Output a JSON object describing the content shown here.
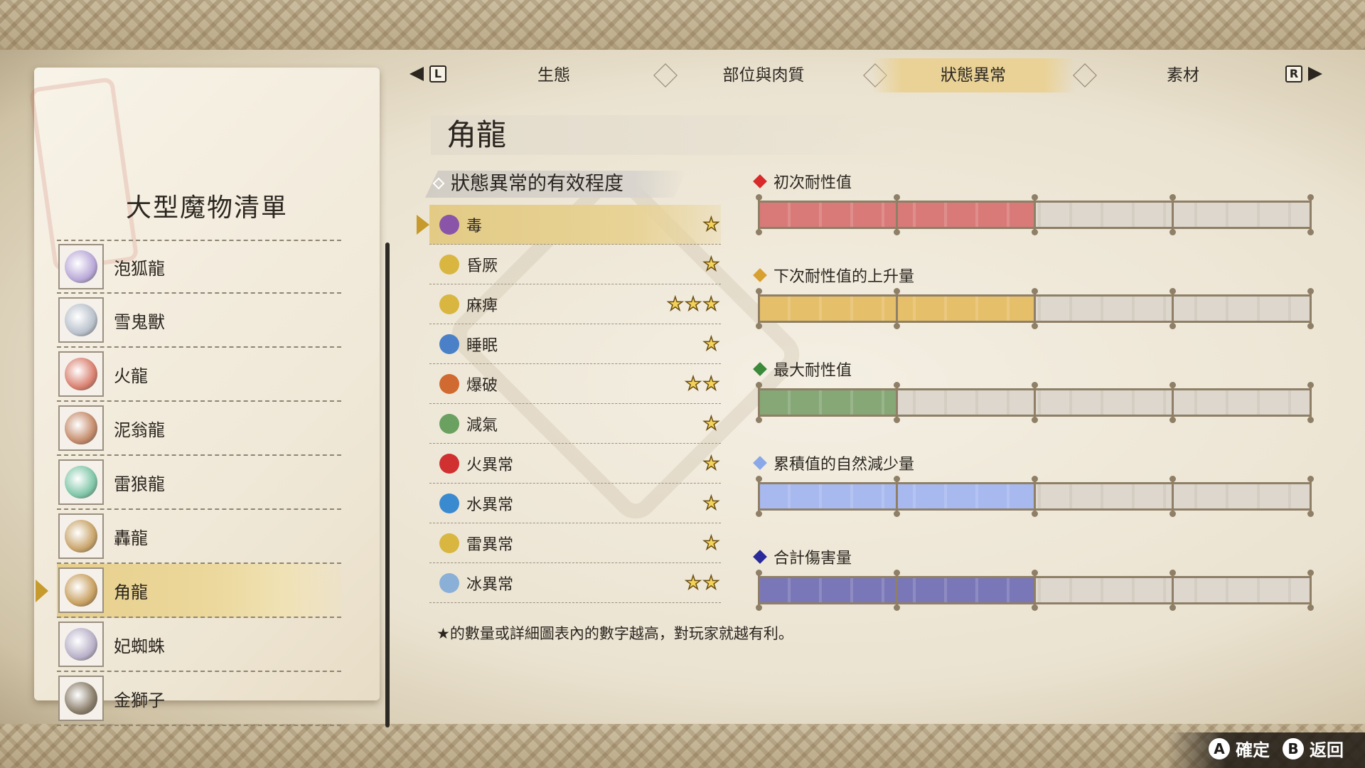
{
  "tabs": [
    {
      "label": "生態",
      "active": false
    },
    {
      "label": "部位與肉質",
      "active": false
    },
    {
      "label": "狀態異常",
      "active": true
    },
    {
      "label": "素材",
      "active": false
    }
  ],
  "tab_nav": {
    "left": "L",
    "right": "R"
  },
  "left_panel": {
    "title": "大型魔物清單",
    "monsters": [
      {
        "name": "泡狐龍",
        "icon": "mizutsune-icon",
        "color": "#b9a8d8"
      },
      {
        "name": "雪鬼獸",
        "icon": "goss-harag-icon",
        "color": "#b9c1cc"
      },
      {
        "name": "火龍",
        "icon": "rathalos-icon",
        "color": "#d9806f"
      },
      {
        "name": "泥翁龍",
        "icon": "almudron-icon",
        "color": "#c48a6a"
      },
      {
        "name": "雷狼龍",
        "icon": "zinogre-icon",
        "color": "#7fc6a8"
      },
      {
        "name": "轟龍",
        "icon": "tigrex-icon",
        "color": "#c9a46a"
      },
      {
        "name": "角龍",
        "icon": "diablos-icon",
        "color": "#c8a060",
        "selected": true
      },
      {
        "name": "妃蜘蛛",
        "icon": "rakna-kadaki-icon",
        "color": "#b8b0c8"
      },
      {
        "name": "金獅子",
        "icon": "rajang-icon",
        "color": "#8a7d6a"
      }
    ],
    "scroll": {
      "position": 0.65
    }
  },
  "monster_title": "角龍",
  "section_header": "狀態異常的有效程度",
  "status_effects": [
    {
      "name": "毒",
      "stars": "★",
      "icon": "poison-icon",
      "color": "#8a55a8",
      "selected": true
    },
    {
      "name": "昏厥",
      "stars": "★",
      "icon": "stun-icon",
      "color": "#d8b640"
    },
    {
      "name": "麻痺",
      "stars": "★★★",
      "icon": "paralysis-icon",
      "color": "#d8b640"
    },
    {
      "name": "睡眠",
      "stars": "★",
      "icon": "sleep-icon",
      "color": "#4a80c8"
    },
    {
      "name": "爆破",
      "stars": "★★",
      "icon": "blast-icon",
      "color": "#d06a30"
    },
    {
      "name": "減氣",
      "stars": "★",
      "icon": "exhaust-icon",
      "color": "#6aa060"
    },
    {
      "name": "火異常",
      "stars": "★",
      "icon": "fireblight-icon",
      "color": "#d03030"
    },
    {
      "name": "水異常",
      "stars": "★",
      "icon": "waterblight-icon",
      "color": "#3a8ad0"
    },
    {
      "name": "雷異常",
      "stars": "★",
      "icon": "thunderblight-icon",
      "color": "#d8b640"
    },
    {
      "name": "冰異常",
      "stars": "★★",
      "icon": "iceblight-icon",
      "color": "#8ab0d8"
    }
  ],
  "bars": [
    {
      "label": "初次耐性值",
      "level": 2,
      "max": 4,
      "color": "#d97a78",
      "marker": "#d82a2a"
    },
    {
      "label": "下次耐性值的上升量",
      "level": 2,
      "max": 4,
      "color": "#e6bf6a",
      "marker": "#d8a030"
    },
    {
      "label": "最大耐性值",
      "level": 1,
      "max": 4,
      "color": "#86a877",
      "marker": "#3a8a3a"
    },
    {
      "label": "累積值的自然減少量",
      "level": 2,
      "max": 4,
      "color": "#a7b9ef",
      "marker": "#8aa8e8"
    },
    {
      "label": "合計傷害量",
      "level": 2,
      "max": 4,
      "color": "#7a77b8",
      "marker": "#2a2a9a"
    }
  ],
  "footnote": "★的數量或詳細圖表內的數字越高，對玩家就越有利。",
  "hints": [
    {
      "button": "A",
      "label": "確定"
    },
    {
      "button": "B",
      "label": "返回"
    }
  ]
}
